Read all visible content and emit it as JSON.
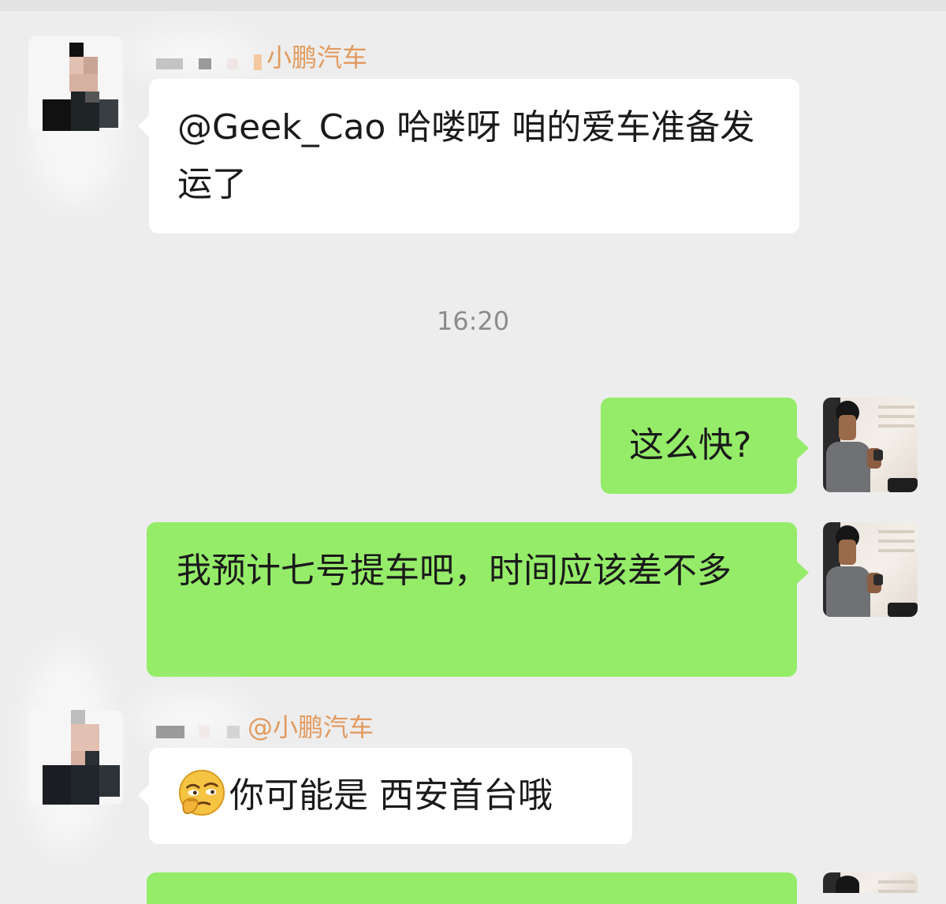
{
  "messages": [
    {
      "sender_name_visible": "小鹏汽车",
      "text": "@Geek_Cao  哈喽呀 咱的爱车准备发运了"
    },
    {
      "timestamp": "16:20"
    },
    {
      "text": "这么快?"
    },
    {
      "text": "我预计七号提车吧，时间应该差不多"
    },
    {
      "sender_name_visible": "@小鹏汽车",
      "emoji": "thinking-face-emoji",
      "text": "你可能是 西安首台哦"
    }
  ],
  "colors": {
    "background": "#ededed",
    "incoming_bubble": "#ffffff",
    "outgoing_bubble": "#95ec69",
    "sender_name": "#e29a5e",
    "timestamp": "#8c8c8c"
  }
}
